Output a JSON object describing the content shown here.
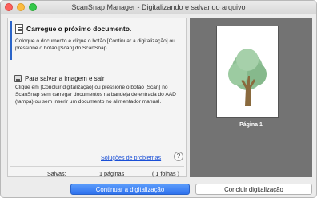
{
  "window": {
    "title": "ScanSnap Manager - Digitalizando e salvando arquivo"
  },
  "step1": {
    "title": "Carregue o próximo documento.",
    "body": "Coloque o documento e clique o botão [Continuar a digitalização] ou pressione o botão [Scan] do ScanSnap."
  },
  "step2": {
    "title": "Para salvar a imagem e sair",
    "body": "Clique em [Concluir digitalização] ou pressione o botão [Scan] no ScanSnap sem carregar documentos na bandeja de entrada do AAD (tampa) ou sem inserir um documento no alimentador manual."
  },
  "help": {
    "link": "Soluções de problemas",
    "button": "?"
  },
  "saved": {
    "label": "Salvas:",
    "pages": "1 páginas",
    "sheets": "( 1 folhas )"
  },
  "preview": {
    "page_label": "Página 1"
  },
  "buttons": {
    "continue": "Continuar a digitalização",
    "finish": "Concluir digitalização"
  },
  "colors": {
    "accent": "#2a64c8",
    "primary_button": "#3b82f6",
    "preview_bg": "#737373",
    "link": "#1a4fd6"
  }
}
